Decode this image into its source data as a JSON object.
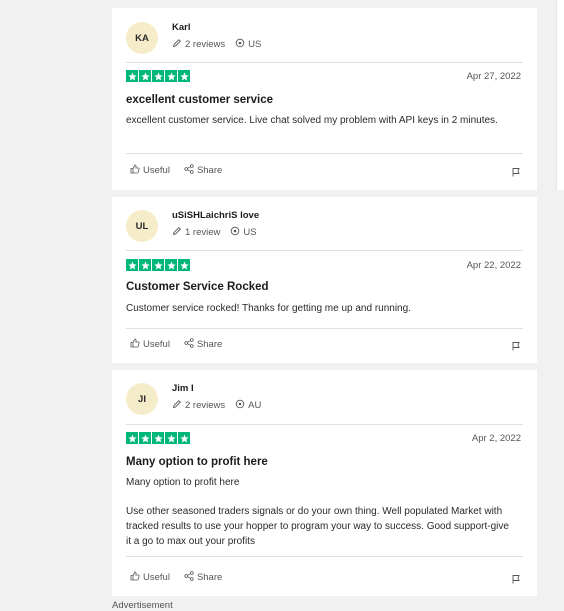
{
  "reviews": [
    {
      "initials": "KA",
      "name": "Karl",
      "review_count": "2 reviews",
      "country": "US",
      "date": "Apr 27, 2022",
      "title": "excellent customer service",
      "body": "excellent customer service. Live chat solved my problem with API keys in 2 minutes.",
      "body2": "",
      "useful_label": "Useful",
      "share_label": "Share"
    },
    {
      "initials": "UL",
      "name": "uSiSHLaichriS love",
      "review_count": "1 review",
      "country": "US",
      "date": "Apr 22, 2022",
      "title": "Customer Service Rocked",
      "body": "Customer service rocked! Thanks for getting me up and running.",
      "body2": "",
      "useful_label": "Useful",
      "share_label": "Share"
    },
    {
      "initials": "JI",
      "name": "Jim I",
      "review_count": "2 reviews",
      "country": "AU",
      "date": "Apr 2, 2022",
      "title": "Many option to profit here",
      "body": "Many option to profit here",
      "body2": "Use other seasoned traders signals or do your own thing. Well populated Market with tracked results to use your hopper to program your way to success. Good support-give it a go to max out your profits",
      "useful_label": "Useful",
      "share_label": "Share"
    }
  ],
  "rating": 5,
  "colors": {
    "star_bg": "#00b67a",
    "avatar_bg": "#f5edc9"
  },
  "footer": {
    "text": "Advertisement"
  }
}
